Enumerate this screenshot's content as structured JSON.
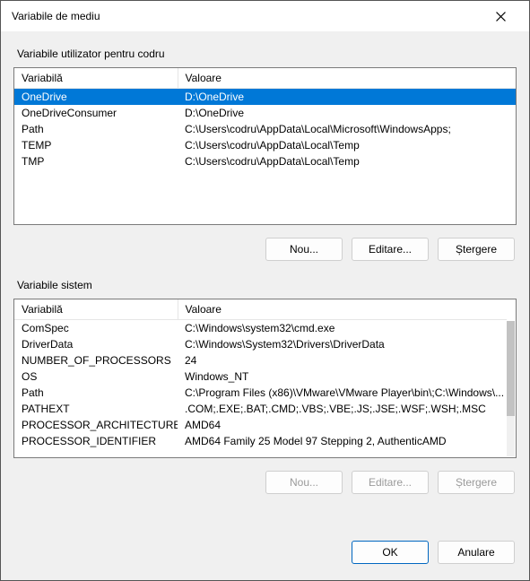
{
  "window": {
    "title": "Variabile de mediu"
  },
  "user": {
    "group_label": "Variabile utilizator pentru codru",
    "columns": {
      "var": "Variabilă",
      "val": "Valoare"
    },
    "rows": [
      {
        "var": "OneDrive",
        "val": "D:\\OneDrive",
        "selected": true
      },
      {
        "var": "OneDriveConsumer",
        "val": "D:\\OneDrive"
      },
      {
        "var": "Path",
        "val": "C:\\Users\\codru\\AppData\\Local\\Microsoft\\WindowsApps;"
      },
      {
        "var": "TEMP",
        "val": "C:\\Users\\codru\\AppData\\Local\\Temp"
      },
      {
        "var": "TMP",
        "val": "C:\\Users\\codru\\AppData\\Local\\Temp"
      }
    ],
    "buttons": {
      "new": "Nou...",
      "edit": "Editare...",
      "delete": "Ștergere"
    }
  },
  "system": {
    "group_label": "Variabile sistem",
    "columns": {
      "var": "Variabilă",
      "val": "Valoare"
    },
    "rows": [
      {
        "var": "ComSpec",
        "val": "C:\\Windows\\system32\\cmd.exe"
      },
      {
        "var": "DriverData",
        "val": "C:\\Windows\\System32\\Drivers\\DriverData"
      },
      {
        "var": "NUMBER_OF_PROCESSORS",
        "val": "24"
      },
      {
        "var": "OS",
        "val": "Windows_NT"
      },
      {
        "var": "Path",
        "val": "C:\\Program Files (x86)\\VMware\\VMware Player\\bin\\;C:\\Windows\\..."
      },
      {
        "var": "PATHEXT",
        "val": ".COM;.EXE;.BAT;.CMD;.VBS;.VBE;.JS;.JSE;.WSF;.WSH;.MSC"
      },
      {
        "var": "PROCESSOR_ARCHITECTURE",
        "val": "AMD64"
      },
      {
        "var": "PROCESSOR_IDENTIFIER",
        "val": "AMD64 Family 25 Model 97 Stepping 2, AuthenticAMD"
      }
    ],
    "buttons": {
      "new": "Nou...",
      "edit": "Editare...",
      "delete": "Ștergere",
      "enabled": false
    }
  },
  "footer": {
    "ok": "OK",
    "cancel": "Anulare"
  }
}
